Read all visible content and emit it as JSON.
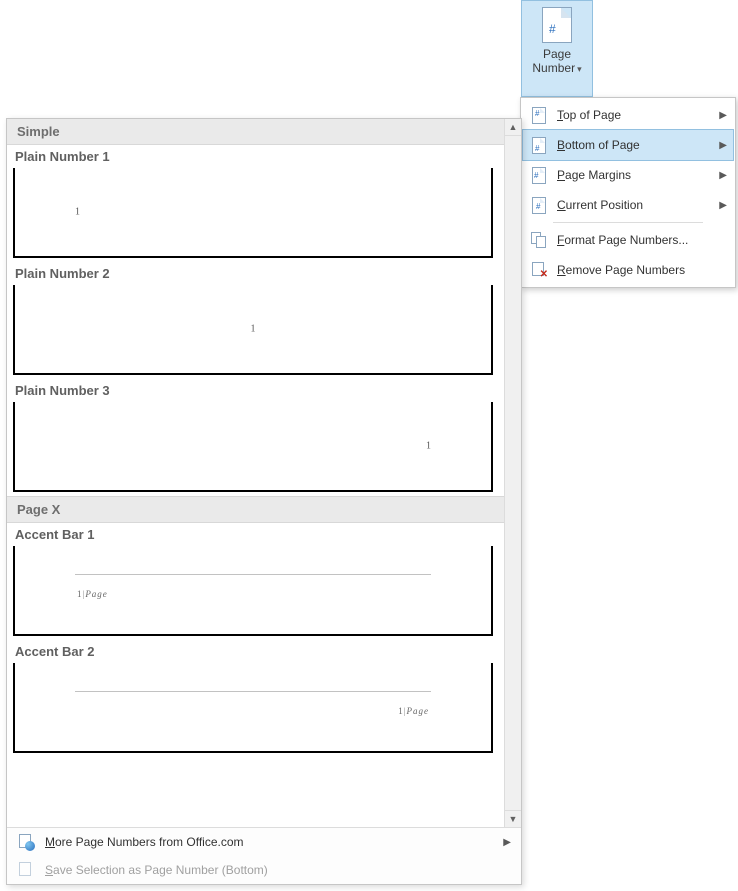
{
  "ribbon_button": {
    "label_line1": "Page",
    "label_line2": "Number"
  },
  "menu": {
    "items": [
      {
        "label_pre": "",
        "label_ul": "T",
        "label_post": "op of Page",
        "has_submenu": true,
        "highlighted": false,
        "icon": "top"
      },
      {
        "label_pre": "",
        "label_ul": "B",
        "label_post": "ottom of Page",
        "has_submenu": true,
        "highlighted": true,
        "icon": "bottom"
      },
      {
        "label_pre": "",
        "label_ul": "P",
        "label_post": "age Margins",
        "has_submenu": true,
        "highlighted": false,
        "icon": "margin"
      },
      {
        "label_pre": "",
        "label_ul": "C",
        "label_post": "urrent Position",
        "has_submenu": true,
        "highlighted": false,
        "icon": "current"
      },
      {
        "label_pre": "",
        "label_ul": "F",
        "label_post": "ormat Page Numbers...",
        "has_submenu": false,
        "highlighted": false,
        "icon": "format"
      },
      {
        "label_pre": "",
        "label_ul": "R",
        "label_post": "emove Page Numbers",
        "has_submenu": false,
        "highlighted": false,
        "icon": "remove"
      }
    ]
  },
  "gallery": {
    "sections": {
      "simple": "Simple",
      "pagex": "Page X"
    },
    "items": {
      "p1": "Plain Number 1",
      "p2": "Plain Number 2",
      "p3": "Plain Number 3",
      "a1": "Accent Bar 1",
      "a2": "Accent Bar 2"
    },
    "preview_num": "1",
    "accent_prefix": "1",
    "accent_bar": "|",
    "accent_page": "Page",
    "footer": {
      "more": {
        "pre": "",
        "ul": "M",
        "post": "ore Page Numbers from Office.com"
      },
      "save": {
        "pre": "",
        "ul": "S",
        "post": "ave Selection as Page Number (Bottom)"
      }
    }
  }
}
